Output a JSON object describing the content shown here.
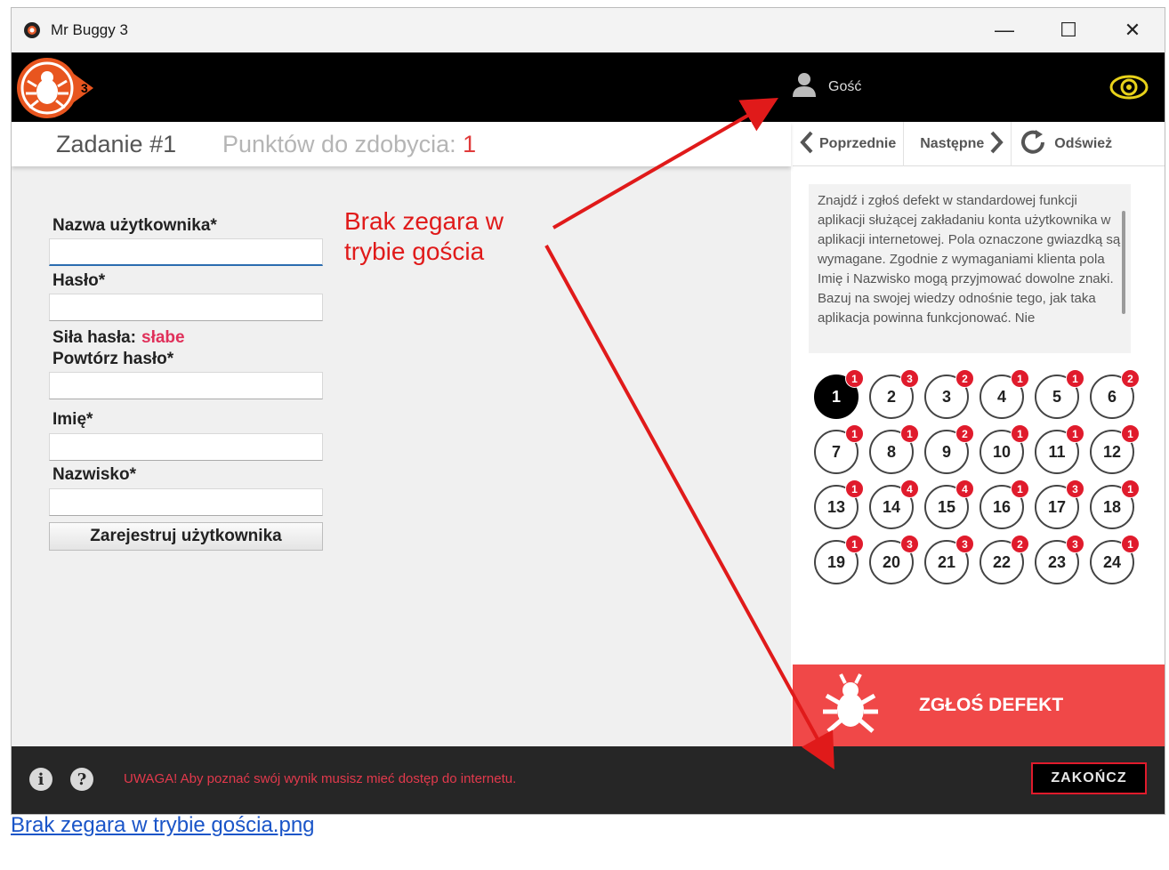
{
  "window": {
    "title": "Mr Buggy 3",
    "controls": {
      "minimize": "—",
      "maximize": "☐",
      "close": "✕"
    }
  },
  "header": {
    "logo_badge": "3",
    "user_label": "Gość"
  },
  "toolbar": {
    "task_title": "Zadanie #1",
    "points_label": "Punktów do zdobycia: ",
    "points_value": "1"
  },
  "nav": {
    "prev": "Poprzednie",
    "next": "Następne",
    "refresh": "Odśwież"
  },
  "form": {
    "username_label": "Nazwa użytkownika*",
    "password_label": "Hasło*",
    "strength_label": "Siła hasła:",
    "strength_value": "słabe",
    "repeat_label": "Powtórz hasło*",
    "firstname_label": "Imię*",
    "lastname_label": "Nazwisko*",
    "register_button": "Zarejestruj użytkownika"
  },
  "annotation": {
    "line1": "Brak zegara w",
    "line2": "trybie gościa",
    "color": "#e01a1a"
  },
  "description": "Znajdź i zgłoś defekt w standardowej funkcji aplikacji służącej zakładaniu konta użytkownika w aplikacji internetowej. Pola oznaczone gwiazdką są wymagane. Zgodnie z wymaganiami klienta pola Imię i Nazwisko mogą przyjmować dowolne znaki. Bazuj na swojej wiedzy odnośnie tego, jak taka aplikacja powinna funkcjonować. Nie",
  "tasks": [
    {
      "n": "1",
      "badge": "1",
      "current": true
    },
    {
      "n": "2",
      "badge": "3"
    },
    {
      "n": "3",
      "badge": "2"
    },
    {
      "n": "4",
      "badge": "1"
    },
    {
      "n": "5",
      "badge": "1"
    },
    {
      "n": "6",
      "badge": "2"
    },
    {
      "n": "7",
      "badge": "1"
    },
    {
      "n": "8",
      "badge": "1"
    },
    {
      "n": "9",
      "badge": "2"
    },
    {
      "n": "10",
      "badge": "1"
    },
    {
      "n": "11",
      "badge": "1"
    },
    {
      "n": "12",
      "badge": "1"
    },
    {
      "n": "13",
      "badge": "1"
    },
    {
      "n": "14",
      "badge": "4"
    },
    {
      "n": "15",
      "badge": "4"
    },
    {
      "n": "16",
      "badge": "1"
    },
    {
      "n": "17",
      "badge": "3"
    },
    {
      "n": "18",
      "badge": "1"
    },
    {
      "n": "19",
      "badge": "1"
    },
    {
      "n": "20",
      "badge": "3"
    },
    {
      "n": "21",
      "badge": "3"
    },
    {
      "n": "22",
      "badge": "2"
    },
    {
      "n": "23",
      "badge": "3"
    },
    {
      "n": "24",
      "badge": "1"
    }
  ],
  "report": {
    "label": "ZGŁOŚ DEFEKT",
    "color": "#f04848"
  },
  "footer": {
    "info_icon": "i",
    "help_icon": "?",
    "warning": "UWAGA! Aby poznać swój wynik musisz mieć dostęp do internetu.",
    "end_button": "ZAKOŃCZ"
  },
  "file_link": "Brak zegara w trybie gościa.png"
}
